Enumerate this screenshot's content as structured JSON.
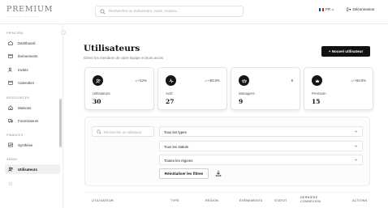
{
  "brand": {
    "name": "PREMIUM",
    "tagline": "—— ——— ——— ——"
  },
  "topbar": {
    "search_placeholder": "Rechercher un événement, invité, maison...",
    "language": "FR",
    "logout_label": "Déconnexion"
  },
  "sidebar": {
    "sections": [
      {
        "title": "PRINCIPAL",
        "items": [
          {
            "label": "Dashboard",
            "icon": "home-icon"
          },
          {
            "label": "Événements",
            "icon": "calendar-icon"
          },
          {
            "label": "Invités",
            "icon": "users-icon"
          },
          {
            "label": "Calendrier",
            "icon": "calendar-icon"
          }
        ]
      },
      {
        "title": "RESSOURCES",
        "items": [
          {
            "label": "Maisons",
            "icon": "house-icon"
          },
          {
            "label": "Fournisseurs",
            "icon": "truck-icon"
          }
        ]
      },
      {
        "title": "FINANCES",
        "items": [
          {
            "label": "Synthèse",
            "icon": "chart-icon"
          }
        ]
      },
      {
        "title": "ADMIN",
        "items": [
          {
            "label": "Utilisateurs",
            "icon": "users-icon",
            "active": true
          }
        ]
      }
    ]
  },
  "main": {
    "title": "Utilisateurs",
    "subtitle": "Gérez les membres de votre équipe et leurs accès",
    "new_button": "+ Nouvel utilisateur"
  },
  "cards": [
    {
      "label": "Utilisateurs",
      "value": "30",
      "trend": "+12%",
      "trend_icon": "arrow-up-icon"
    },
    {
      "label": "Actif",
      "value": "27",
      "trend": "+90.0%",
      "trend_icon": "arrow-up-icon"
    },
    {
      "label": "Managers",
      "value": "9",
      "trend": "9",
      "trend_icon": ""
    },
    {
      "label": "Premium",
      "value": "15",
      "trend": "+50.0%",
      "trend_icon": "arrow-up-icon"
    }
  ],
  "filters": {
    "search_placeholder": "Rechercher un utilisateur",
    "types": "Tous les types",
    "statuts": "Tous les statuts",
    "regions": "Toutes les régions",
    "reset_label": "Réinitialiser les filtres"
  },
  "table": {
    "headers": [
      "UTILISATEUR",
      "TYPE",
      "RÉGION",
      "ÉVÉNEMENTS",
      "STATUT",
      "DERNIÈRE CONNEXION",
      "ACTIONS"
    ]
  }
}
